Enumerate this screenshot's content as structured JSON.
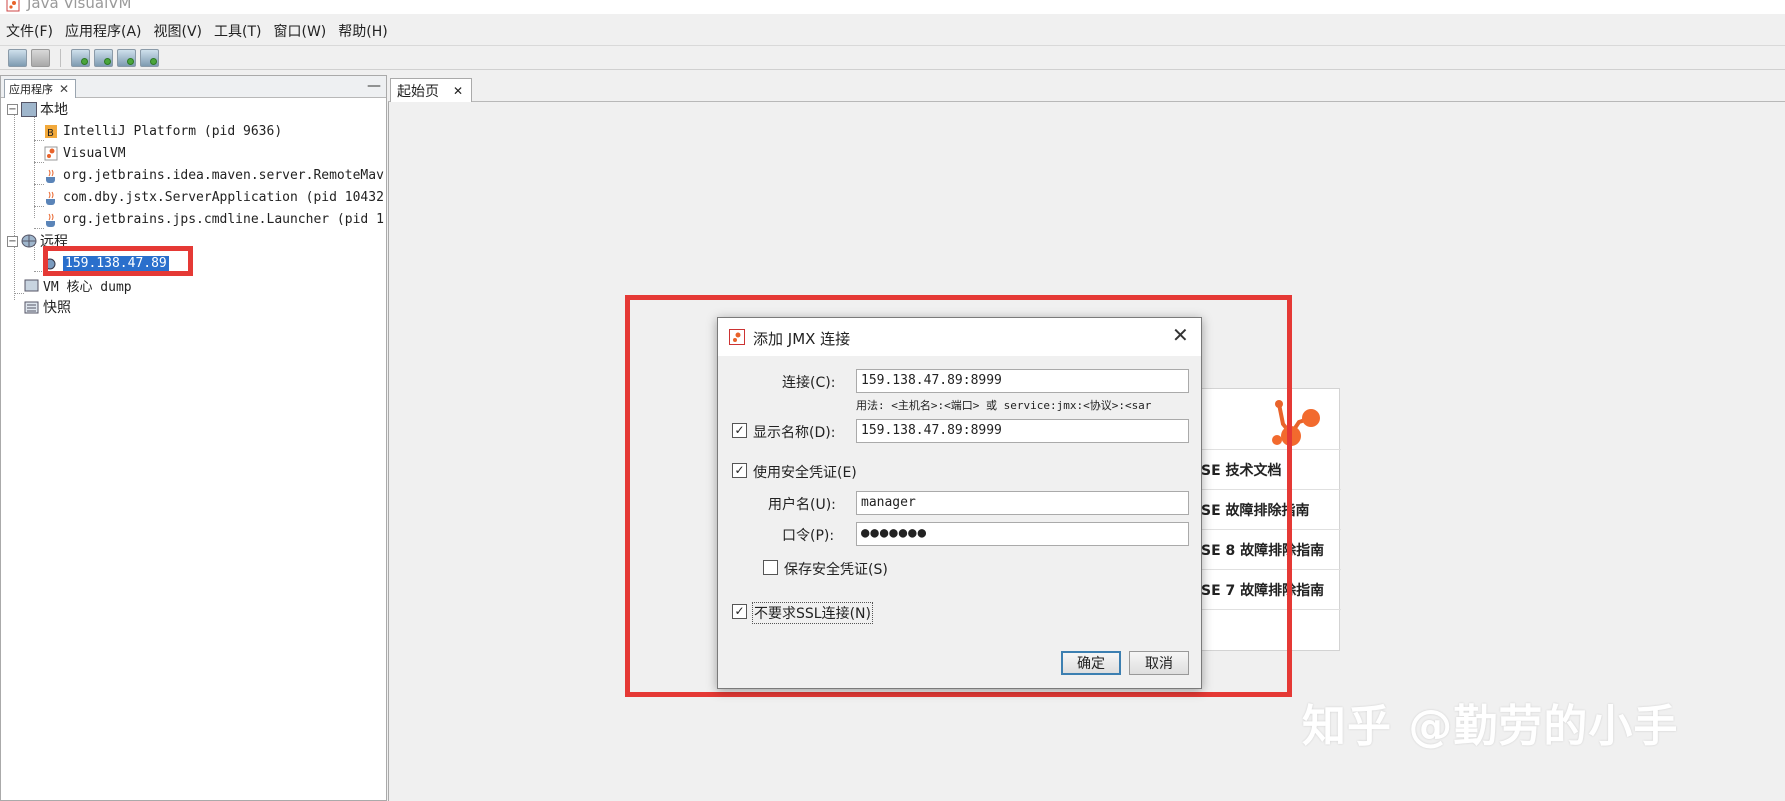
{
  "window": {
    "title": "Java VisualVM"
  },
  "menu": [
    "文件(F)",
    "应用程序(A)",
    "视图(V)",
    "工具(T)",
    "窗口(W)",
    "帮助(H)"
  ],
  "toolbar": {
    "icons": [
      "open-snapshot-icon",
      "save-icon",
      "add-jmx-connection-icon",
      "add-remote-host-icon",
      "add-vm-coredump-icon",
      "add-jmx-application-icon"
    ]
  },
  "left_panel": {
    "tab_label": "应用程序",
    "tree": {
      "local": "本地",
      "local_items": [
        "IntelliJ Platform (pid 9636)",
        "VisualVM",
        "org.jetbrains.idea.maven.server.RemoteMav",
        "com.dby.jstx.ServerApplication (pid 10432",
        "org.jetbrains.jps.cmdline.Launcher (pid 1"
      ],
      "remote": "远程",
      "remote_host": "159.138.47.89",
      "vm_coredump": "VM 核心 dump",
      "snapshots": "快照"
    }
  },
  "main": {
    "tab_label": "起始页",
    "start_page_items": [
      "SE 技术文档",
      "SE 故障排除指南",
      "SE 8 故障排除指南",
      "SE 7 故障排除指南"
    ]
  },
  "dialog": {
    "title": "添加 JMX 连接",
    "connection_label": "连接(C):",
    "connection_value": "159.138.47.89:8999",
    "usage_hint": "用法: <主机名>:<端口> 或 service:jmx:<协议>:<sar",
    "display_name_label": "显示名称(D):",
    "display_name_checked": true,
    "display_name_value": "159.138.47.89:8999",
    "use_credentials_label": "使用安全凭证(E)",
    "use_credentials_checked": true,
    "username_label": "用户名(U):",
    "username_value": "manager",
    "password_label": "口令(P):",
    "password_value": "●●●●●●●",
    "save_credentials_label": "保存安全凭证(S)",
    "save_credentials_checked": false,
    "no_ssl_label": "不要求SSL连接(N)",
    "no_ssl_checked": true,
    "ok_label": "确定",
    "cancel_label": "取消"
  },
  "watermark": "知乎 @勤劳的小手",
  "colors": {
    "annotation_red": "#e53935",
    "selection_blue": "#2a6fcc"
  }
}
